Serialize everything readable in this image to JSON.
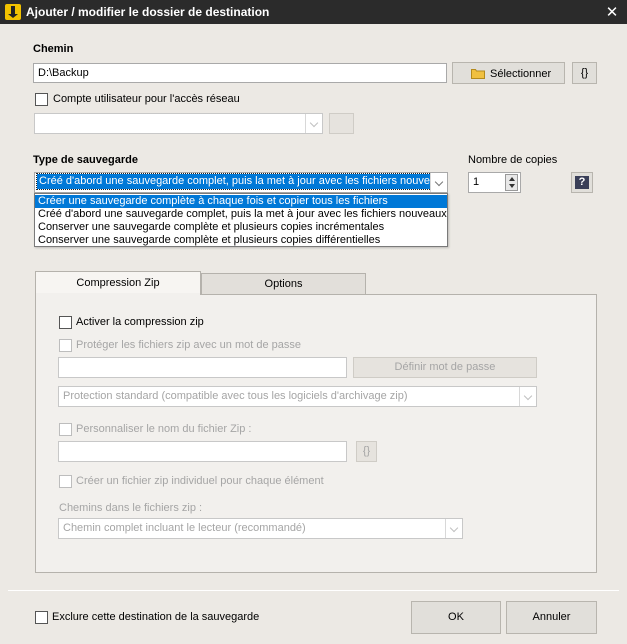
{
  "window": {
    "title": "Ajouter / modifier le dossier de destination"
  },
  "path": {
    "label": "Chemin",
    "value": "D:\\Backup",
    "select_button": "Sélectionner",
    "vars_button": "{}"
  },
  "network": {
    "checkbox_label": "Compte utilisateur pour l'accès réseau",
    "checked": false,
    "account_value": ""
  },
  "backup_type": {
    "label": "Type de sauvegarde",
    "selected": "Créé d'abord une sauvegarde complet, puis la met à jour avec les fichiers nouveaux o",
    "options": [
      "Créer une sauvegarde complète à chaque fois et copier tous les fichiers",
      "Créé d'abord une sauvegarde complet, puis la met à jour avec les fichiers nouveaux o",
      "Conserver une sauvegarde complète et plusieurs copies incrémentales",
      "Conserver une sauvegarde complète et plusieurs copies différentielles"
    ],
    "highlighted_index": 0
  },
  "copies": {
    "label": "Nombre de copies",
    "value": "1",
    "help_button": "?"
  },
  "tabs": [
    {
      "label": "Compression Zip",
      "active": true
    },
    {
      "label": "Options",
      "active": false
    }
  ],
  "zip": {
    "enable_label": "Activer la compression zip",
    "enable_checked": false,
    "password_label": "Protéger les fichiers zip avec un mot de passe",
    "password_value": "",
    "set_password_button": "Définir mot de passe",
    "protection_option": "Protection standard (compatible avec tous les logiciels d'archivage zip)",
    "custom_name_label": "Personnaliser le nom du fichier Zip :",
    "custom_name_value": "",
    "custom_name_vars_button": "{}",
    "individual_label": "Créer un fichier zip individuel pour chaque élément",
    "paths_label": "Chemins dans le fichiers zip :",
    "paths_option": "Chemin complet incluant le lecteur (recommandé)"
  },
  "footer": {
    "exclude_label": "Exclure cette destination de la sauvegarde",
    "exclude_checked": false,
    "ok_button": "OK",
    "cancel_button": "Annuler"
  },
  "colors": {
    "titlebar": "#2b2b2b",
    "background": "#ece9e4",
    "selection": "#0078d7",
    "folder": "#f0c040"
  }
}
